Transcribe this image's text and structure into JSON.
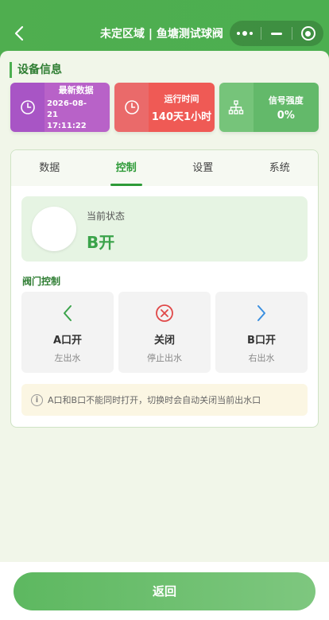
{
  "header": {
    "title": "未定区域 | 鱼塘测试球阀",
    "icons": [
      "chevron-left-icon",
      "more-dots-icon",
      "minimize-icon",
      "target-icon"
    ]
  },
  "device_info": {
    "section_title": "设备信息",
    "cards": [
      {
        "label": "最新数据",
        "value": "2026-08-21 17:11:22",
        "icon": "clock-icon",
        "color": "#b862c8"
      },
      {
        "label": "运行时间",
        "value": "140天1小时",
        "icon": "clock-icon",
        "color": "#ef5a55"
      },
      {
        "label": "信号强度",
        "value": "0%",
        "icon": "network-icon",
        "color": "#63b96a"
      }
    ]
  },
  "tabs": [
    "数据",
    "控制",
    "设置",
    "系统"
  ],
  "active_tab": "控制",
  "status": {
    "label": "当前状态",
    "value": "B开"
  },
  "valve": {
    "title": "阀门控制",
    "buttons": [
      {
        "label": "A口开",
        "sub": "左出水",
        "icon": "chevron-left-icon",
        "color": "#3aa34a"
      },
      {
        "label": "关闭",
        "sub": "停止出水",
        "icon": "close-circle-icon",
        "color": "#e04848"
      },
      {
        "label": "B口开",
        "sub": "右出水",
        "icon": "chevron-right-icon",
        "color": "#3a8fe0"
      }
    ]
  },
  "notice": "A口和B口不能同时打开，切换时会自动关闭当前出水口",
  "bottom": {
    "return_label": "返回"
  }
}
